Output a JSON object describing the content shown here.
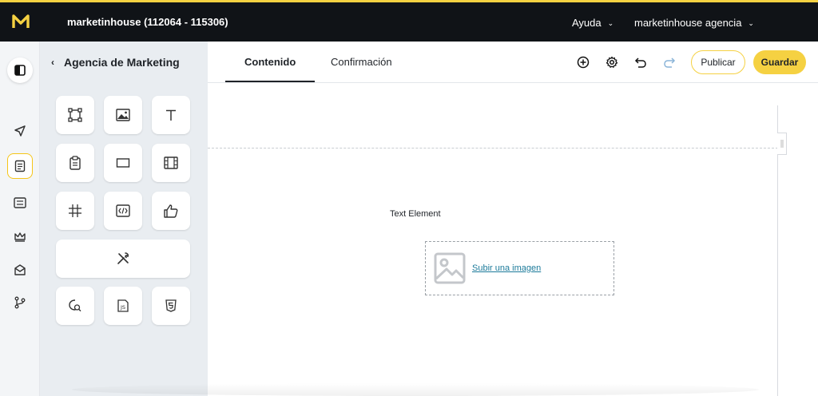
{
  "header": {
    "account_title": "marketinhouse (112064 - 115306)",
    "help_label": "Ayuda",
    "agency_label": "marketinhouse agencia",
    "accent_color": "#f5d142"
  },
  "rail": {
    "items": [
      "panel-toggle-icon",
      "send-icon",
      "document-icon",
      "list-icon",
      "crown-icon",
      "mail-icon",
      "branch-icon"
    ]
  },
  "panel": {
    "title": "Agencia de Marketing",
    "tiles": [
      "frame-icon",
      "image-icon",
      "text-icon",
      "clipboard-icon",
      "rectangle-icon",
      "video-icon",
      "grid-icon",
      "code-icon",
      "thumbs-up-icon",
      "tools-icon",
      "search-chat-icon",
      "js-icon",
      "css-icon"
    ]
  },
  "tabs": [
    {
      "label": "Contenido",
      "active": true
    },
    {
      "label": "Confirmación",
      "active": false
    }
  ],
  "toolbar": {
    "publish_label": "Publicar",
    "save_label": "Guardar"
  },
  "canvas": {
    "text_element": "Text Element",
    "upload_link": "Subir una imagen"
  }
}
